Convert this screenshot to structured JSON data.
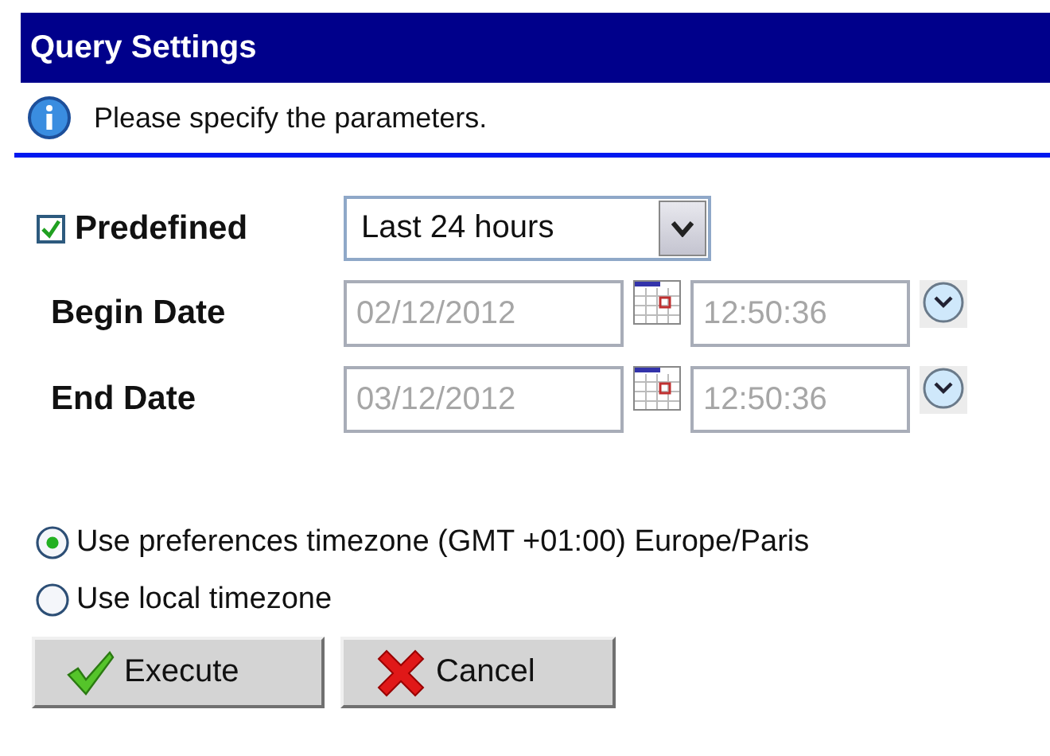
{
  "panel": {
    "title": "Query Settings",
    "info": "Please specify the parameters."
  },
  "predefined": {
    "label": "Predefined",
    "checked": true,
    "value": "Last 24 hours"
  },
  "dates": [
    {
      "label": "Begin Date",
      "date": "02/12/2012",
      "time": "12:50:36",
      "disabled": true
    },
    {
      "label": "End Date",
      "date": "03/12/2012",
      "time": "12:50:36",
      "disabled": true
    }
  ],
  "timezones": [
    {
      "label": "Use preferences timezone (GMT +01:00) Europe/Paris",
      "selected": true
    },
    {
      "label": "Use local timezone",
      "selected": false
    }
  ],
  "buttons": [
    {
      "label": "Execute",
      "kind": "execute"
    },
    {
      "label": "Cancel",
      "kind": "cancel"
    }
  ]
}
